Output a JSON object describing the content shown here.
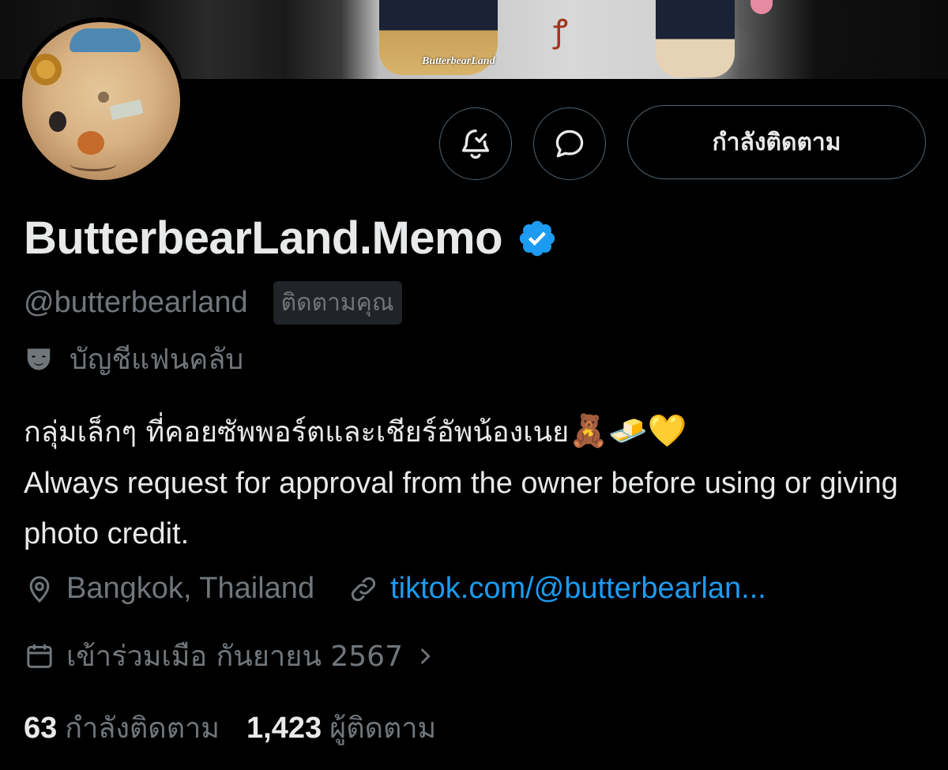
{
  "banner": {
    "watermark": "ButterbearLand"
  },
  "actions": {
    "notify_icon": "bell-check-icon",
    "message_icon": "message-bubble-icon",
    "following_label": "กำลังติดตาม"
  },
  "profile": {
    "display_name": "ButterbearLand.Memo",
    "verified_icon": "verified-badge-icon",
    "handle": "@butterbearland",
    "follows_you_label": "ติดตามคุณ",
    "fan_account_label": "บัญชีแฟนคลับ",
    "bio": {
      "line1": "กลุ่มเล็กๆ ที่คอยซัพพอร์ตและเชียร์อัพน้องเนย",
      "emojis": "🧸🧈💛",
      "line2": "Always request for approval from the owner before using or giving photo credit."
    },
    "location": "Bangkok, Thailand",
    "website": "tiktok.com/@butterbearlan...",
    "joined": "เข้าร่วมเมือ กันยายน 2567",
    "following_count": "63",
    "following_label": "กำลังติดตาม",
    "followers_count": "1,423",
    "followers_label": "ผู้ติดตาม"
  },
  "colors": {
    "background": "#000000",
    "text_primary": "#e7e9ea",
    "text_secondary": "#71767b",
    "link": "#1d9bf0",
    "border": "#536471",
    "verified": "#1d9bf0"
  }
}
